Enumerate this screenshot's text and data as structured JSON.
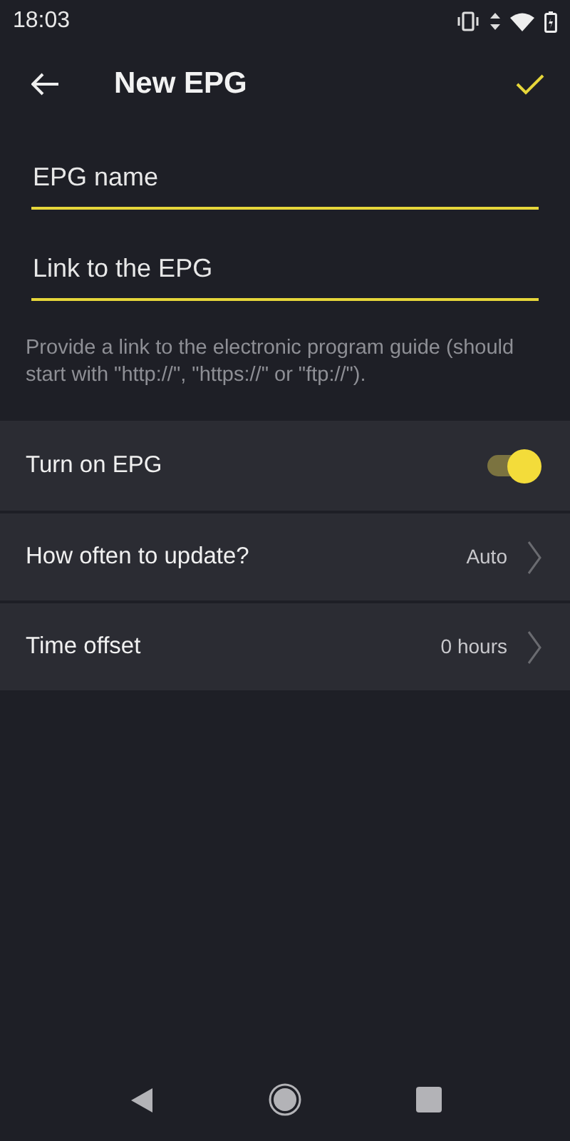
{
  "status_bar": {
    "time": "18:03"
  },
  "toolbar": {
    "title": "New EPG"
  },
  "fields": [
    {
      "placeholder": "EPG name"
    },
    {
      "placeholder": "Link to the EPG"
    }
  ],
  "hint": "Provide a link to the electronic program guide (should start with \"http://\", \"https://\" or \"ftp://\").",
  "settings": [
    {
      "kind": "toggle",
      "label": "Turn on EPG",
      "on": true
    },
    {
      "kind": "value",
      "label": "How often to update?",
      "value": "Auto"
    },
    {
      "kind": "value",
      "label": "Time offset",
      "value": "0 hours"
    }
  ]
}
